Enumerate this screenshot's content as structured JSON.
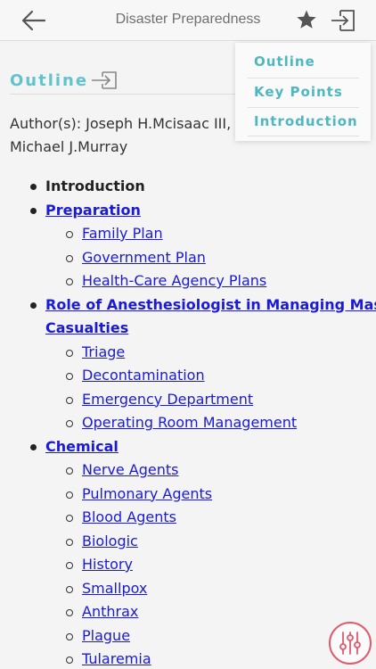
{
  "header": {
    "title": "Disaster Preparedness",
    "back_icon": "arrow-left-icon",
    "favorite_icon": "star-icon",
    "exit_icon": "exit-icon"
  },
  "outline": {
    "heading": "Outline",
    "icon": "exit-icon",
    "author_line1": "Author(s): Joseph H.Mcisaac III, C",
    "author_line2": "Michael J.Murray"
  },
  "toc": [
    {
      "label": "Introduction",
      "level": 1,
      "link": false
    },
    {
      "label": "Preparation",
      "level": 1,
      "link": true
    },
    {
      "label": "Family Plan",
      "level": 2
    },
    {
      "label": "Government Plan",
      "level": 2
    },
    {
      "label": "Health-Care Agency Plans",
      "level": 2
    },
    {
      "label": "Role of Anesthesiologist in Managing Mass",
      "level": 1,
      "link": true
    },
    {
      "label": "Casualties",
      "level": 1,
      "link": true,
      "continuation": true
    },
    {
      "label": "Triage",
      "level": 2
    },
    {
      "label": "Decontamination",
      "level": 2
    },
    {
      "label": "Emergency Department",
      "level": 2
    },
    {
      "label": "Operating Room Management",
      "level": 2
    },
    {
      "label": "Chemical",
      "level": 1,
      "link": true
    },
    {
      "label": "Nerve Agents",
      "level": 2
    },
    {
      "label": "Pulmonary Agents",
      "level": 2
    },
    {
      "label": "Blood Agents",
      "level": 2
    },
    {
      "label": "Biologic",
      "level": 2
    },
    {
      "label": "History",
      "level": 2
    },
    {
      "label": "Smallpox",
      "level": 2
    },
    {
      "label": "Anthrax",
      "level": 2
    },
    {
      "label": "Plague",
      "level": 2
    },
    {
      "label": "Tularemia",
      "level": 2
    }
  ],
  "popup_menu": {
    "items": [
      "Outline",
      "Key Points",
      "Introduction"
    ]
  },
  "fab": {
    "icon": "sliders-icon"
  },
  "colors": {
    "accent": "#62c3cc",
    "link": "#1a1ad8",
    "fab": "#e05a6d"
  }
}
